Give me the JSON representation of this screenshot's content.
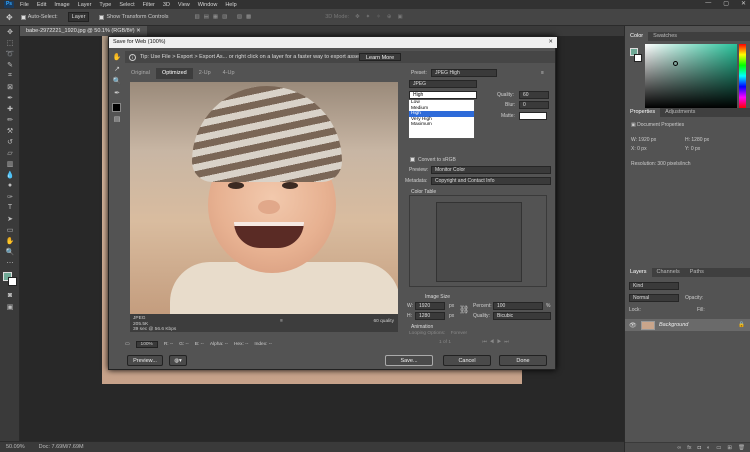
{
  "app": {
    "logo": "Ps",
    "menu": [
      "File",
      "Edit",
      "Image",
      "Layer",
      "Type",
      "Select",
      "Filter",
      "3D",
      "View",
      "Window",
      "Help"
    ],
    "window_controls": [
      "—",
      "▢",
      "✕"
    ]
  },
  "options_bar": {
    "auto_select_label": "Auto-Select:",
    "auto_select_value": "Layer",
    "show_transform_label": "Show Transform Controls",
    "mode_label": "3D Mode:"
  },
  "document": {
    "tab_title": "babe-2972221_1920.jpg @ 50.1% (RGB/8#)",
    "zoom": "50.09%",
    "doc_size": "Doc: 7.69M/7.69M"
  },
  "right_panel": {
    "color_tabs": [
      "Color",
      "Swatches"
    ],
    "properties_tabs": [
      "Properties",
      "Adjustments"
    ],
    "document_properties_label": "Document Properties",
    "w_label": "W:",
    "w_value": "1920 px",
    "h_label": "H:",
    "h_value": "1280 px",
    "x_label": "X:",
    "x_value": "0 px",
    "y_label": "Y:",
    "y_value": "0 px",
    "resolution": "Resolution: 300 pixels/inch",
    "layers_tabs": [
      "Layers",
      "Channels",
      "Paths"
    ],
    "kind_label": "Kind",
    "blend_mode": "Normal",
    "opacity_label": "Opacity:",
    "lock_label": "Lock:",
    "fill_label": "Fill:",
    "layer_name": "Background",
    "fg_color": "#6fa996"
  },
  "dialog": {
    "title": "Save for Web (100%)",
    "tip": "Tip: Use File > Export > Export As...   or right click on a layer for a faster way to export assets",
    "learn_more": "Learn More",
    "view_tabs": [
      "Original",
      "Optimized",
      "2-Up",
      "4-Up"
    ],
    "active_view": "Optimized",
    "preview_info_line1": "JPEG",
    "preview_info_line2": "205.5K",
    "preview_info_line3": "39 sec @ 56.6 Kbps",
    "preview_quality": "60 quality",
    "zoom_value": "100%",
    "r_label": "R: --",
    "g_label": "G: --",
    "b_label": "B: --",
    "alpha_label": "Alpha: --",
    "hex_label": "Hex: --",
    "index_label": "Index: --",
    "preset_label": "Preset:",
    "preset_value": "JPEG High",
    "format_value": "JPEG",
    "quality_dropdown_value": "High",
    "quality_options": [
      "Low",
      "Medium",
      "High",
      "Very High",
      "Maximum"
    ],
    "quality_selected_index": 2,
    "quality_label": "Quality:",
    "quality_value": "60",
    "blur_label": "Blur:",
    "blur_value": "0",
    "matte_label": "Matte:",
    "convert_srgb": "Convert to sRGB",
    "preview_label": "Preview:",
    "preview_value": "Monitor Color",
    "metadata_label": "Metadata:",
    "metadata_value": "Copyright and Contact Info",
    "color_table_label": "Color Table",
    "image_size_label": "Image Size",
    "w_label": "W:",
    "w_value": "1920",
    "h_label": "H:",
    "h_value": "1280",
    "px": "px",
    "percent_label": "Percent:",
    "percent_value": "100",
    "percent_sign": "%",
    "size_quality_label": "Quality:",
    "size_quality_value": "Bicubic",
    "animation_label": "Animation",
    "looping_label": "Looping Options:",
    "looping_value": "Forever",
    "frame_counter": "1 of 1",
    "preview_button": "Preview...",
    "save_button": "Save...",
    "cancel_button": "Cancel",
    "done_button": "Done"
  }
}
